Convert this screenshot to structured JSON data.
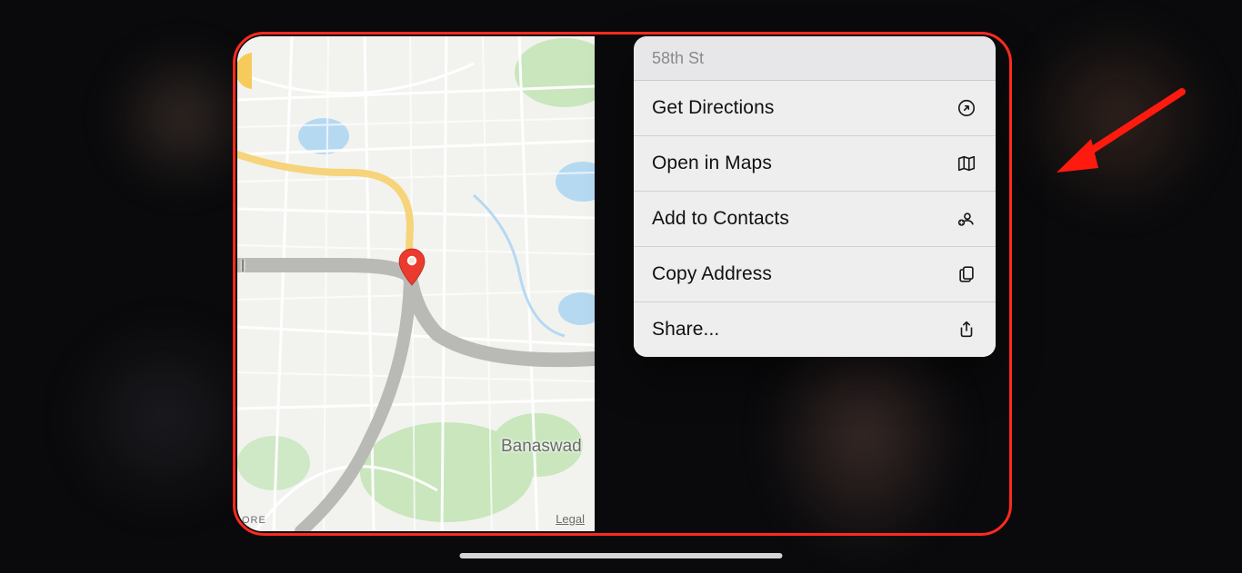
{
  "context_menu": {
    "header": "58th St",
    "items": [
      {
        "label": "Get Directions",
        "icon": "directions-icon"
      },
      {
        "label": "Open in Maps",
        "icon": "map-icon"
      },
      {
        "label": "Add to Contacts",
        "icon": "add-contact-icon"
      },
      {
        "label": "Copy Address",
        "icon": "copy-icon"
      },
      {
        "label": "Share...",
        "icon": "share-icon"
      }
    ]
  },
  "map": {
    "label_left_truncated": "l",
    "label_banaswadi": "Banaswad",
    "label_bottom_left": "ORE",
    "legal": "Legal",
    "pin_dropped": true
  },
  "annotation": {
    "highlight_color": "#ff2a1f"
  }
}
